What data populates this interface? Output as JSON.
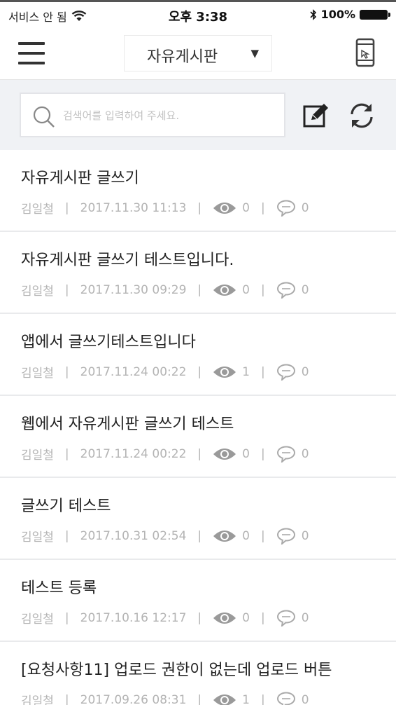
{
  "status_bar": {
    "carrier": "서비스 안 됨",
    "time": "오후 3:38",
    "battery": "100%"
  },
  "nav": {
    "board_name": "자유게시판",
    "dropdown_icon": "triangle-down-icon"
  },
  "search": {
    "placeholder": "검색어를 입력하여 주세요."
  },
  "posts": [
    {
      "title": "자유게시판 글쓰기",
      "author": "김일철",
      "date": "2017.11.30 11:13",
      "views": "0",
      "comments": "0"
    },
    {
      "title": "자유게시판 글쓰기 테스트입니다.",
      "author": "김일철",
      "date": "2017.11.30 09:29",
      "views": "0",
      "comments": "0"
    },
    {
      "title": "앱에서 글쓰기테스트입니다",
      "author": "김일철",
      "date": "2017.11.24 00:22",
      "views": "1",
      "comments": "0"
    },
    {
      "title": "웹에서 자유게시판 글쓰기 테스트",
      "author": "김일철",
      "date": "2017.11.24 00:22",
      "views": "0",
      "comments": "0"
    },
    {
      "title": "글쓰기 테스트",
      "author": "김일철",
      "date": "2017.10.31 02:54",
      "views": "0",
      "comments": "0"
    },
    {
      "title": "테스트 등록",
      "author": "김일철",
      "date": "2017.10.16 12:17",
      "views": "0",
      "comments": "0"
    },
    {
      "title": "[요청사항11]  업로드 권한이 없는데 업로드 버튼",
      "author": "김일철",
      "date": "2017.09.26 08:31",
      "views": "1",
      "comments": "0"
    }
  ],
  "colors": {
    "search_area_bg": "#f0f2f5",
    "meta_text": "#b4b4b4",
    "title_text": "#222222"
  }
}
